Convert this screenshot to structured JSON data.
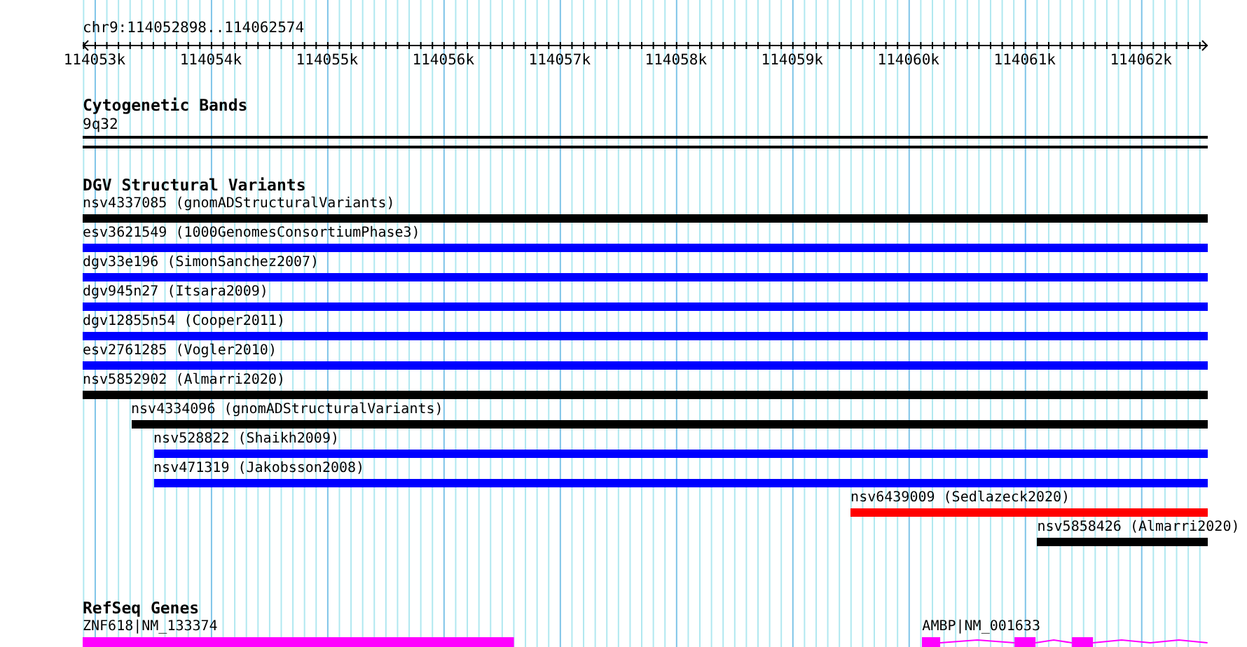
{
  "ruler": {
    "location": "chr9:114052898..114062574",
    "ticks": [
      {
        "label": "114053k"
      },
      {
        "label": "114054k"
      },
      {
        "label": "114055k"
      },
      {
        "label": "114056k"
      },
      {
        "label": "114057k"
      },
      {
        "label": "114058k"
      },
      {
        "label": "114059k"
      },
      {
        "label": "114060k"
      },
      {
        "label": "114061k"
      },
      {
        "label": "114062k"
      }
    ]
  },
  "tracks": [
    {
      "kind": "cytoband",
      "title": "Cytogenetic Bands",
      "label": "9q32"
    },
    {
      "kind": "variants",
      "title": "DGV Structural Variants",
      "features": [
        {
          "label": "nsv4337085 (gnomADStructuralVariants)",
          "color": "#000000"
        },
        {
          "label": "esv3621549 (1000GenomesConsortiumPhase3)",
          "color": "#0000ff"
        },
        {
          "label": "dgv33e196 (SimonSanchez2007)",
          "color": "#0000ff"
        },
        {
          "label": "dgv945n27 (Itsara2009)",
          "color": "#0000ff"
        },
        {
          "label": "dgv12855n54 (Cooper2011)",
          "color": "#0000ff"
        },
        {
          "label": "esv2761285 (Vogler2010)",
          "color": "#0000ff"
        },
        {
          "label": "nsv5852902 (Almarri2020)",
          "color": "#000000"
        },
        {
          "label": "nsv4334096 (gnomADStructuralVariants)",
          "color": "#000000"
        },
        {
          "label": "nsv528822 (Shaikh2009)",
          "color": "#0000ff"
        },
        {
          "label": "nsv471319 (Jakobsson2008)",
          "color": "#0000ff"
        },
        {
          "label": "nsv6439009 (Sedlazeck2020)",
          "color": "#ff0000"
        },
        {
          "label": "nsv5858426 (Almarri2020)",
          "color": "#000000"
        }
      ]
    },
    {
      "kind": "genes",
      "title": "RefSeq Genes",
      "features": [
        {
          "label": "ZNF618|NM_133374",
          "color": "#ff00ff"
        },
        {
          "label": "AMBP|NM_001633",
          "color": "#ff00ff"
        }
      ]
    }
  ]
}
